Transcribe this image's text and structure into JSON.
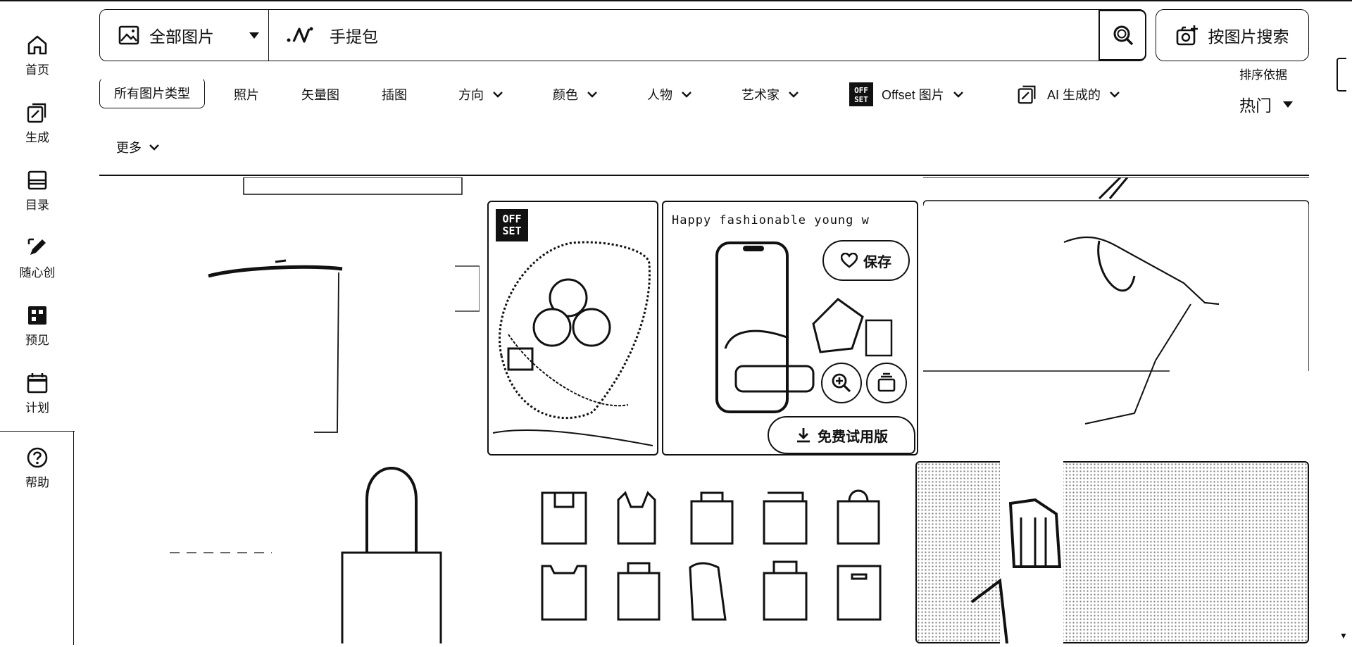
{
  "nav": {
    "items": [
      {
        "label": "首页"
      },
      {
        "label": "生成"
      },
      {
        "label": "目录"
      },
      {
        "label": "随心创"
      },
      {
        "label": "预见"
      },
      {
        "label": "计划"
      }
    ],
    "help": {
      "label": "帮助"
    }
  },
  "search": {
    "scope_label": "全部图片",
    "query": "手提包",
    "image_search_label": "按图片搜索"
  },
  "filters": {
    "all_types": "所有图片类型",
    "photos": "照片",
    "vectors": "矢量图",
    "illustrations": "插图",
    "orientation": "方向",
    "color": "颜色",
    "people": "人物",
    "artists": "艺术家",
    "offset": "Offset 图片",
    "ai_generated": "AI 生成的",
    "more": "更多",
    "sort_caption": "排序依据",
    "sort_value": "热门"
  },
  "tiles": {
    "offset_badge": "OFF\nSET",
    "hover_title": "Happy fashionable young w",
    "save_label": "保存",
    "trial_label": "免费试用版"
  },
  "icons": {
    "home": "home-icon",
    "generate": "generate-icon",
    "catalog": "catalog-icon",
    "create": "pen-icon",
    "preview": "grid-icon",
    "plan": "calendar-icon",
    "help": "help-icon"
  }
}
